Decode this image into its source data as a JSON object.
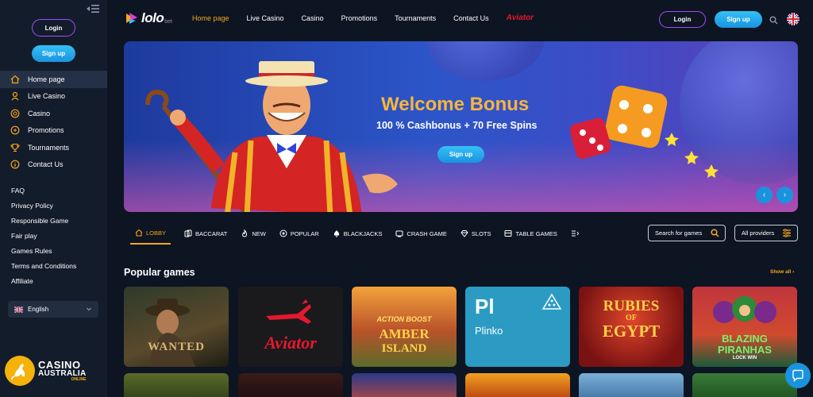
{
  "sidebar": {
    "login_label": "Login",
    "signup_label": "Sign up",
    "nav": [
      {
        "label": "Home page",
        "icon": "home-icon",
        "active": true
      },
      {
        "label": "Live Casino",
        "icon": "dealer-icon"
      },
      {
        "label": "Casino",
        "icon": "chip-icon"
      },
      {
        "label": "Promotions",
        "icon": "megaphone-icon"
      },
      {
        "label": "Tournaments",
        "icon": "trophy-icon"
      },
      {
        "label": "Contact Us",
        "icon": "info-icon"
      }
    ],
    "links": [
      "FAQ",
      "Privacy Policy",
      "Responsible Game",
      "Fair play",
      "Games Rules",
      "Terms and Conditions",
      "Affiliate"
    ],
    "language": "English"
  },
  "watermark": {
    "line1": "CASINO",
    "line2": "AUSTRALIA",
    "line3": "ONLINE"
  },
  "header": {
    "logo": "lolo",
    "logo_suffix": "bet",
    "nav": [
      "Home page",
      "Live Casino",
      "Casino",
      "Promotions",
      "Tournaments",
      "Contact Us"
    ],
    "aviator": "Aviator",
    "login_label": "Login",
    "signup_label": "Sign up"
  },
  "banner": {
    "title": "Welcome Bonus",
    "subtitle": "100 % Cashbonus + 70 Free Spins",
    "cta": "Sign up",
    "prev": "‹",
    "next": "›"
  },
  "categories": [
    {
      "label": "LOBBY",
      "icon": "lobby-icon",
      "active": true
    },
    {
      "label": "BACCARAT",
      "icon": "cards-icon"
    },
    {
      "label": "NEW",
      "icon": "flame-icon"
    },
    {
      "label": "POPULAR",
      "icon": "popular-icon"
    },
    {
      "label": "BLACKJACKS",
      "icon": "spade-icon"
    },
    {
      "label": "CRASH GAME",
      "icon": "crash-icon"
    },
    {
      "label": "SLOTS",
      "icon": "diamond-icon"
    },
    {
      "label": "TABLE GAMES",
      "icon": "table-icon"
    }
  ],
  "search_games_placeholder": "Search for games",
  "providers_label": "All providers",
  "popular": {
    "title": "Popular games",
    "show_all": "Show all",
    "games": [
      {
        "name": "WANTED"
      },
      {
        "name": "Aviator"
      },
      {
        "name": "ACTION BOOST AMBER ISLAND",
        "line1": "ACTION BOOST",
        "line2": "AMBER",
        "line3": "ISLAND"
      },
      {
        "name": "Plinko",
        "abbr": "Pl"
      },
      {
        "name": "RUBIES OF EGYPT",
        "line1": "RUBIES",
        "line2": "OF",
        "line3": "EGYPT"
      },
      {
        "name": "BLAZING PIRANHAS",
        "line1": "BLAZING",
        "line2": "PIRANHAS",
        "line3": "LOCK WIN"
      }
    ]
  },
  "colors": {
    "accent": "#f6a71b",
    "primary_button": "#1a93df",
    "outline_button": "#a54bff",
    "background": "#0d1422",
    "sidebar": "#131c2b"
  }
}
